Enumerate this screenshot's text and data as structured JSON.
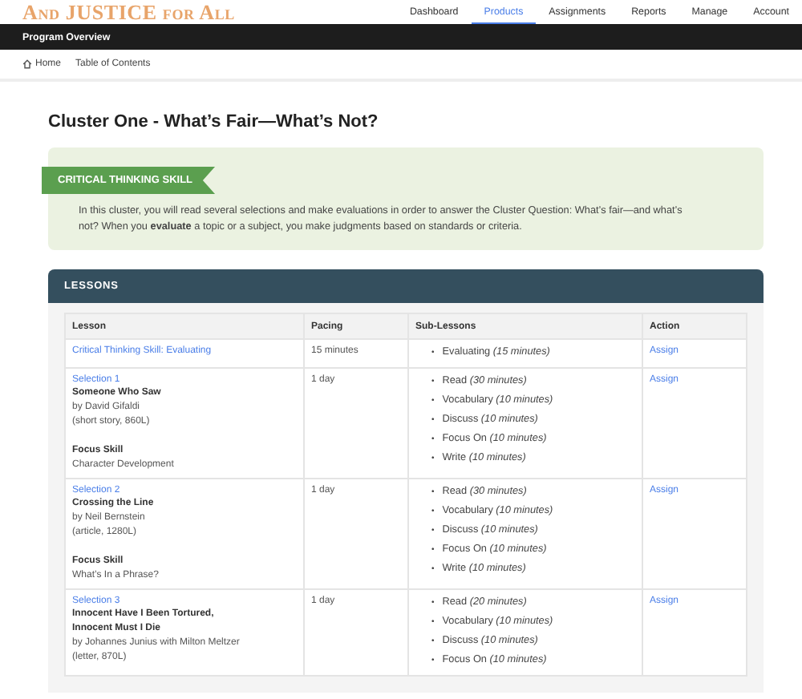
{
  "header": {
    "logo": "And JUSTICE for All",
    "nav": [
      {
        "label": "Dashboard",
        "selected": false
      },
      {
        "label": "Products",
        "selected": true
      },
      {
        "label": "Assignments",
        "selected": false
      },
      {
        "label": "Reports",
        "selected": false
      },
      {
        "label": "Manage",
        "selected": false
      },
      {
        "label": "Account",
        "selected": false
      }
    ]
  },
  "subnav": {
    "title": "Program Overview"
  },
  "breadcrumb": [
    "Home",
    "Table of Contents"
  ],
  "page_title": "Cluster One - What’s Fair—What’s Not?",
  "skill_box": {
    "ribbon": "CRITICAL THINKING SKILL",
    "text": "In this cluster, you will read several selections and make evaluations in order to answer the Cluster Question: What’s fair—and what’s not? When you **evaluate** a topic or a subject, you make judgments based on standards or criteria."
  },
  "lessons": {
    "title": "LESSONS",
    "marker": "•",
    "columns": [
      "Lesson",
      "Pacing",
      "Sub-Lessons",
      "Action"
    ],
    "rows": [
      {
        "link": "Critical Thinking Skill: Evaluating",
        "pacing": "15 minutes",
        "sub_lessons": [
          "Evaluating *(15 minutes)*"
        ],
        "action": "Assign"
      },
      {
        "link": "Selection 1",
        "title": "Someone Who Saw",
        "author": "by David Gifaldi",
        "info": "(short story, 860L)",
        "focus_label": "Focus Skill",
        "focus": "Character Development",
        "pacing": "1 day",
        "sub_lessons": [
          "Read *(30 minutes)*",
          "Vocabulary *(10 minutes)*",
          "Discuss *(10 minutes)*",
          "Focus On *(10 minutes)*",
          "Write *(10 minutes)*"
        ],
        "action": "Assign"
      },
      {
        "link": "Selection 2",
        "title": "Crossing the Line",
        "author": "by Neil Bernstein",
        "info": "(article, 1280L)",
        "focus_label": "Focus Skill",
        "focus": "What’s In a Phrase?",
        "pacing": "1 day",
        "sub_lessons": [
          "Read *(30 minutes)*",
          "Vocabulary *(10 minutes)*",
          "Discuss *(10 minutes)*",
          "Focus On *(10 minutes)*",
          "Write *(10 minutes)*"
        ],
        "action": "Assign"
      },
      {
        "link": "Selection 3",
        "title": "Innocent Have I Been Tortured, Innocent Must I Die",
        "author": "by Johannes Junius with Milton Meltzer",
        "info": "(letter, 870L)",
        "pacing": "1 day",
        "sub_lessons": [
          "Read *(20 minutes)*",
          "Vocabulary *(10 minutes)*",
          "Discuss *(10 minutes)*",
          "Focus On *(10 minutes)*"
        ],
        "action": "Assign"
      }
    ]
  }
}
